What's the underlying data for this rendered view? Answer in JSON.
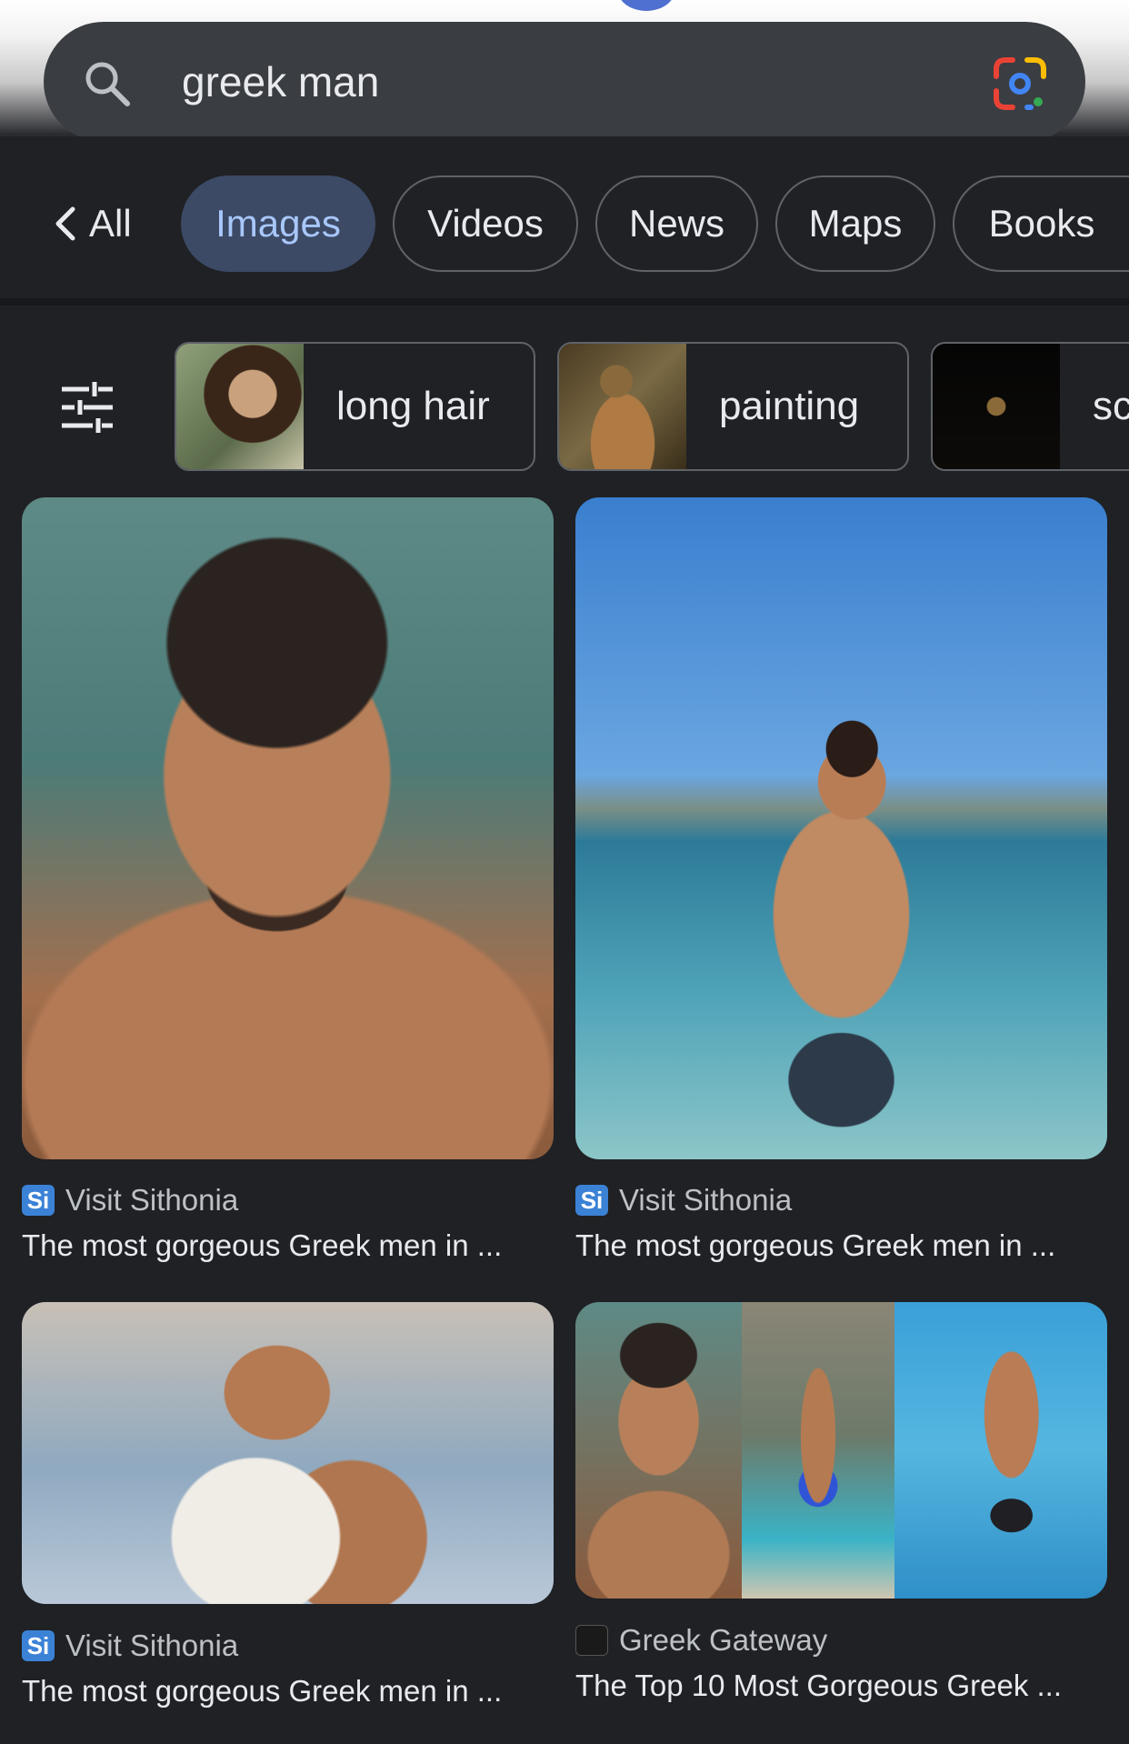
{
  "search": {
    "query": "greek man"
  },
  "tabs": [
    {
      "label": "All"
    },
    {
      "label": "Images",
      "selected": true
    },
    {
      "label": "Videos"
    },
    {
      "label": "News"
    },
    {
      "label": "Maps"
    },
    {
      "label": "Books"
    }
  ],
  "chips": [
    {
      "label": "long hair"
    },
    {
      "label": "painting"
    },
    {
      "label": "sc"
    }
  ],
  "results": [
    {
      "source": "Visit Sithonia",
      "title": "The most gorgeous Greek men in ...",
      "favicon": "si-favicon"
    },
    {
      "source": "Visit Sithonia",
      "title": "The most gorgeous Greek men in ...",
      "favicon": "si-favicon"
    },
    {
      "source": "Visit Sithonia",
      "title": "The most gorgeous Greek men in ...",
      "favicon": "si-favicon"
    },
    {
      "source": "Greek Gateway",
      "title": "The Top 10 Most Gorgeous Greek ...",
      "favicon": "greek-gateway-favicon"
    }
  ],
  "favicon_text": {
    "si": "Si"
  },
  "colors": {
    "accent": "#a8c7fa",
    "selected_tab_bg": "#3c4a66",
    "background": "#1f2125",
    "favicon_blue": "#3b82d6"
  }
}
